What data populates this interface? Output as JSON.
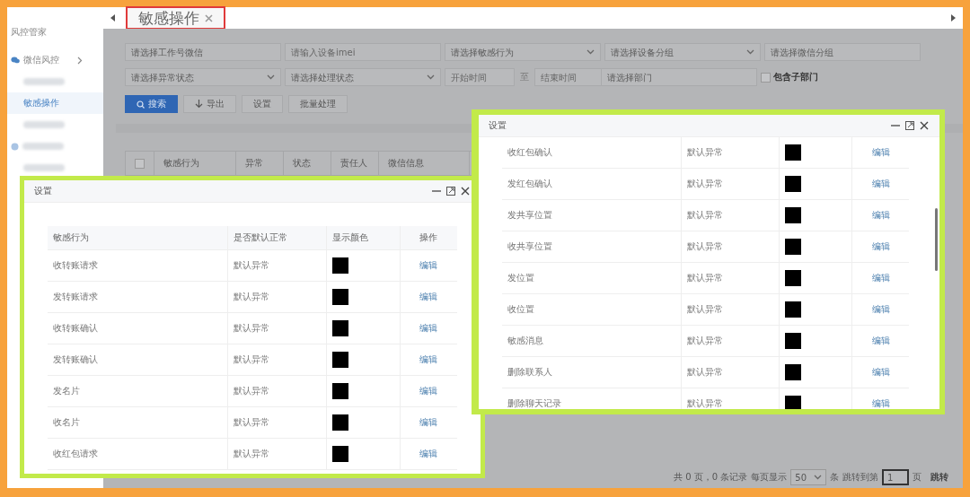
{
  "sidebar": {
    "title": "风控管家",
    "items": [
      {
        "kind": "group",
        "label": "微信风控",
        "selected": false
      },
      {
        "kind": "redacted",
        "selected": false
      },
      {
        "kind": "item",
        "label": "敏感操作",
        "selected": true
      },
      {
        "kind": "redacted",
        "selected": false
      },
      {
        "kind": "redacted_group",
        "selected": false
      },
      {
        "kind": "redacted",
        "selected": false
      }
    ]
  },
  "tabs": [
    {
      "label": "敏感操作",
      "selected": true
    }
  ],
  "filters": [
    {
      "fields": [
        {
          "kind": "input",
          "placeholder": "请选择工作号微信"
        },
        {
          "kind": "input",
          "placeholder": "请输入设备imei"
        },
        {
          "kind": "select",
          "placeholder": "请选择敏感行为"
        },
        {
          "kind": "select",
          "placeholder": "请选择设备分组"
        },
        {
          "kind": "input",
          "placeholder": "请选择微信分组"
        }
      ]
    },
    {
      "fields": [
        {
          "kind": "select",
          "placeholder": "请选择异常状态"
        },
        {
          "kind": "select",
          "placeholder": "请选择处理状态"
        },
        {
          "kind": "daterange",
          "start_placeholder": "开始时间",
          "separator": "至",
          "end_placeholder": "结束时间"
        },
        {
          "kind": "input",
          "placeholder": "请选择部门"
        },
        {
          "kind": "checkbox",
          "label": "包含子部门",
          "checked": false
        }
      ]
    }
  ],
  "toolbar": [
    {
      "kind": "search",
      "label": "搜索"
    },
    {
      "kind": "export",
      "label": "导出"
    },
    {
      "kind": "plain",
      "label": "设置"
    },
    {
      "kind": "plain",
      "label": "批量处理"
    }
  ],
  "table": {
    "select_all": {
      "checked": false
    },
    "columns": [
      "敏感行为",
      "异常",
      "状态",
      "责任人",
      "微信信息"
    ]
  },
  "pagination": {
    "summary": "共 0 页，0 条记录",
    "per_page_label": "每页显示",
    "per_page": "50",
    "unit": "条",
    "jump_label": "跳转到第",
    "page": "1",
    "page_unit": "页",
    "jump_button": "跳转"
  },
  "dialogs": [
    {
      "title": "设置",
      "columns": [
        "敏感行为",
        "是否默认正常",
        "显示颜色",
        "操作"
      ],
      "rows": [
        {
          "behavior": "收转账请求",
          "default": "默认异常",
          "color": "#000000",
          "action": "编辑"
        },
        {
          "behavior": "发转账请求",
          "default": "默认异常",
          "color": "#000000",
          "action": "编辑"
        },
        {
          "behavior": "收转账确认",
          "default": "默认异常",
          "color": "#000000",
          "action": "编辑"
        },
        {
          "behavior": "发转账确认",
          "default": "默认异常",
          "color": "#000000",
          "action": "编辑"
        },
        {
          "behavior": "发名片",
          "default": "默认异常",
          "color": "#000000",
          "action": "编辑"
        },
        {
          "behavior": "收名片",
          "default": "默认异常",
          "color": "#000000",
          "action": "编辑"
        },
        {
          "behavior": "收红包请求",
          "default": "默认异常",
          "color": "#000000",
          "action": "编辑"
        }
      ]
    },
    {
      "title": "设置",
      "rows": [
        {
          "behavior": "收红包确认",
          "default": "默认异常",
          "color": "#000000",
          "action": "编辑"
        },
        {
          "behavior": "发红包确认",
          "default": "默认异常",
          "color": "#000000",
          "action": "编辑"
        },
        {
          "behavior": "发共享位置",
          "default": "默认异常",
          "color": "#000000",
          "action": "编辑"
        },
        {
          "behavior": "收共享位置",
          "default": "默认异常",
          "color": "#000000",
          "action": "编辑"
        },
        {
          "behavior": "发位置",
          "default": "默认异常",
          "color": "#000000",
          "action": "编辑"
        },
        {
          "behavior": "收位置",
          "default": "默认异常",
          "color": "#000000",
          "action": "编辑"
        },
        {
          "behavior": "敏感消息",
          "default": "默认异常",
          "color": "#000000",
          "action": "编辑"
        },
        {
          "behavior": "删除联系人",
          "default": "默认异常",
          "color": "#000000",
          "action": "编辑"
        },
        {
          "behavior": "删除聊天记录",
          "default": "默认异常",
          "color": "#000000",
          "action": "编辑"
        }
      ]
    }
  ]
}
